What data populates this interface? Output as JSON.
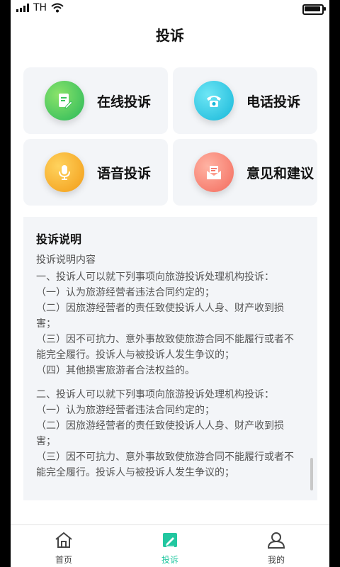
{
  "status": {
    "carrier": "TH",
    "battery_level": 0.9
  },
  "page": {
    "title": "投诉"
  },
  "options": [
    {
      "label": "在线投诉",
      "icon": "document-edit-icon",
      "color": "#28b85a"
    },
    {
      "label": "电话投诉",
      "icon": "telephone-icon",
      "color": "#16b7d9"
    },
    {
      "label": "语音投诉",
      "icon": "microphone-icon",
      "color": "#f29b16"
    },
    {
      "label": "意见和建议",
      "icon": "envelope-icon",
      "color": "#f36a5c"
    }
  ],
  "notice": {
    "title": "投诉说明",
    "subtitle": "投诉说明内容",
    "lines": [
      "一、投诉人可以就下列事项向旅游投诉处理机构投诉：",
      "（一）认为旅游经营者违法合同约定的；",
      "（二）因旅游经营者的责任致使投诉人人身、财产收到损害；",
      "（三）因不可抗力、意外事故致使旅游合同不能履行或者不能完全履行。投诉人与被投诉人发生争议的；",
      "（四）其他损害旅游者合法权益的。",
      "二、投诉人可以就下列事项向旅游投诉处理机构投诉：",
      "（一）认为旅游经营者违法合同约定的；",
      "（二）因旅游经营者的责任致使投诉人人身、财产收到损害；",
      "（三）因不可抗力、意外事故致使旅游合同不能履行或者不能完全履行。投诉人与被投诉人发生争议的；"
    ]
  },
  "tabs": [
    {
      "label": "首页",
      "icon": "home-icon"
    },
    {
      "label": "投诉",
      "icon": "edit-icon"
    },
    {
      "label": "我的",
      "icon": "user-icon"
    }
  ],
  "accent_color": "#21c7a0"
}
